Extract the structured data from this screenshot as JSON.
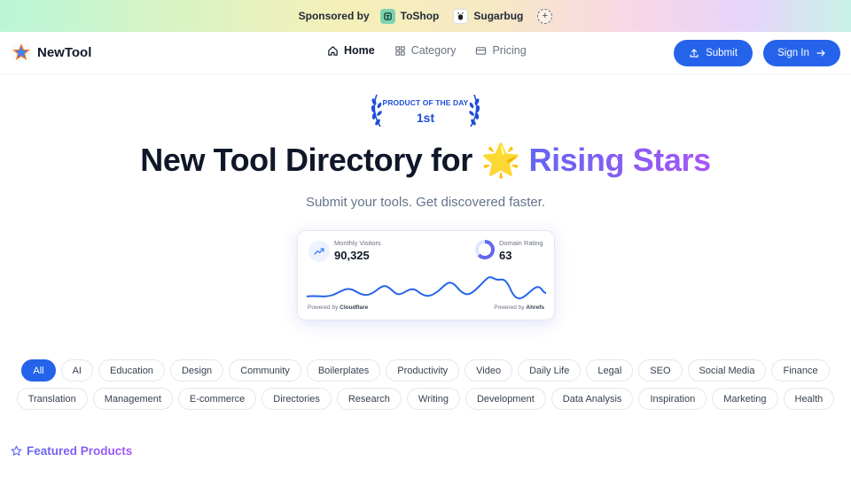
{
  "sponsor": {
    "label": "Sponsored by",
    "items": [
      {
        "name": "ToShop",
        "icon": "toshop-logo"
      },
      {
        "name": "Sugarbug",
        "icon": "sugarbug-logo"
      }
    ],
    "add_icon": "plus-icon"
  },
  "header": {
    "brand": "NewTool",
    "nav": [
      {
        "label": "Home",
        "icon": "home-icon",
        "active": true
      },
      {
        "label": "Category",
        "icon": "grid-icon",
        "active": false
      },
      {
        "label": "Pricing",
        "icon": "card-icon",
        "active": false
      }
    ],
    "submit_label": "Submit",
    "signin_label": "Sign In"
  },
  "badge": {
    "top": "PRODUCT OF THE DAY",
    "rank": "1st"
  },
  "hero": {
    "title_main": "New Tool Directory for",
    "emoji": "🌟",
    "title_accent": "Rising Stars",
    "subtitle": "Submit your tools. Get discovered faster."
  },
  "stats": {
    "visitors_label": "Monthly Visitors",
    "visitors_value": "90,325",
    "rating_label": "Domain Rating",
    "rating_value": "63",
    "rating_fraction": 0.63,
    "powered_left_prefix": "Powered by",
    "powered_left": "Cloudflare",
    "powered_right_prefix": "Powered by",
    "powered_right": "Ahrefs"
  },
  "categories": {
    "row1": [
      "All",
      "AI",
      "Education",
      "Design",
      "Community",
      "Boilerplates",
      "Productivity",
      "Video",
      "Daily Life",
      "Legal",
      "SEO",
      "Social Media",
      "Finance"
    ],
    "row2": [
      "Translation",
      "Management",
      "E-commerce",
      "Directories",
      "Research",
      "Writing",
      "Development",
      "Data Analysis",
      "Inspiration",
      "Marketing",
      "Health"
    ],
    "active": "All"
  },
  "featured": {
    "title": "Featured Products",
    "icon": "star-outline-icon"
  },
  "colors": {
    "primary": "#2563eb",
    "accent_start": "#6366f1",
    "accent_end": "#a855f7"
  }
}
